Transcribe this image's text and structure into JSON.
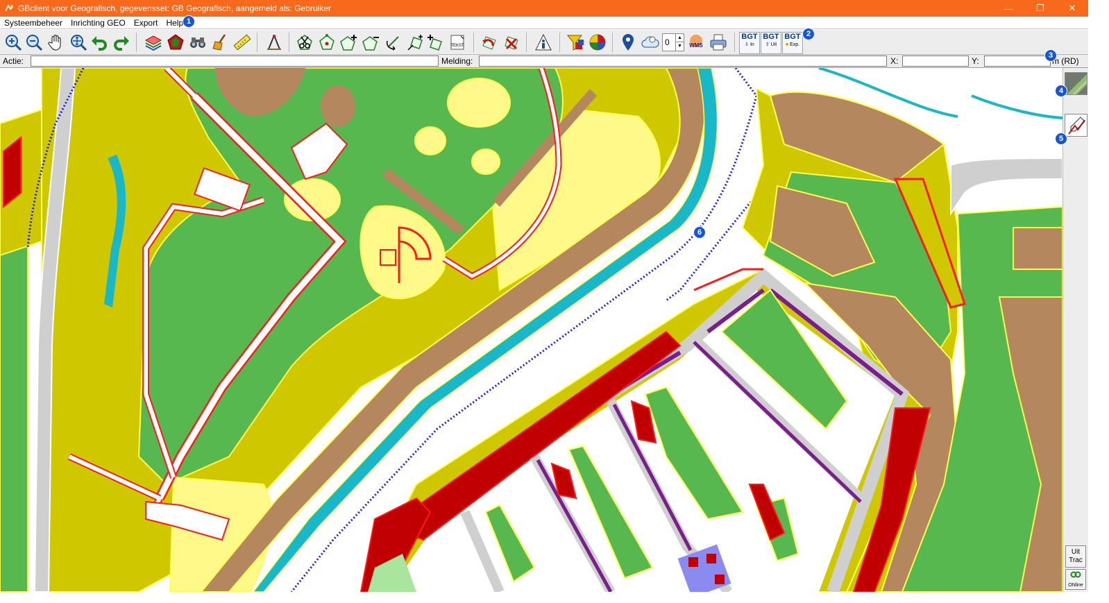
{
  "window": {
    "title": "GBclient voor Geografisch, gegevensset: GB Geografisch, aangemeld als: Gebruiker",
    "minimize_glyph": "—",
    "restore_glyph": "❐",
    "close_glyph": "✕"
  },
  "menu": {
    "items": [
      "Systeembeheer",
      "Inrichting GEO",
      "Export",
      "Help"
    ]
  },
  "toolbar": {
    "zoom_level_value": "0",
    "wms_label": "WMS",
    "bgt_in": {
      "top": "BGT",
      "bottom": "In"
    },
    "bgt_uit": {
      "top": "BGT",
      "bottom": "Uit"
    },
    "bgt_exp": {
      "top": "BGT",
      "bottom": "Exp."
    },
    "icons": [
      "zoom-in-icon",
      "zoom-out-icon",
      "pan-hand-icon",
      "zoom-extent-icon",
      "undo-icon",
      "redo-icon",
      "layers-icon",
      "polygon-icon",
      "binoculars-icon",
      "broom-icon",
      "ruler-icon",
      "compass-icon",
      "cut-icon",
      "vertex-icon",
      "add-vertex-icon",
      "remove-vertex-icon",
      "rotate-icon",
      "move-icon",
      "add-point-icon",
      "text-icon",
      "undo-edit-icon",
      "delete-icon",
      "info-icon",
      "filter-icon",
      "palette-icon",
      "location-pin-icon",
      "cloud-icon",
      "wms-icon",
      "printer-icon"
    ]
  },
  "status": {
    "actie_label": "Actie:",
    "actie_value": "",
    "melding_label": "Melding:",
    "melding_value": "",
    "x_label": "X:",
    "x_value": "",
    "y_label": "Y:",
    "y_value": "",
    "unit_label": "m (RD)"
  },
  "right_panel": {
    "uit_trac_label_1": "Uit",
    "uit_trac_label_2": "Trac",
    "online_label": "ONline"
  },
  "callouts": [
    "1",
    "2",
    "3",
    "4",
    "5",
    "6"
  ],
  "colors": {
    "titlebar": "#f8691b",
    "grass": "#57b850",
    "yellow_fill": "#fff98a",
    "olive": "#cfc800",
    "brown": "#b5875e",
    "road_grey": "#cfcfcf",
    "red_outline": "#ff1a1a",
    "dark_red": "#c00000",
    "purple": "#7a1e8c",
    "water_cyan": "#19b8c8",
    "boundary_blue": "#1d1de0",
    "callout_blue": "#1555d6"
  }
}
